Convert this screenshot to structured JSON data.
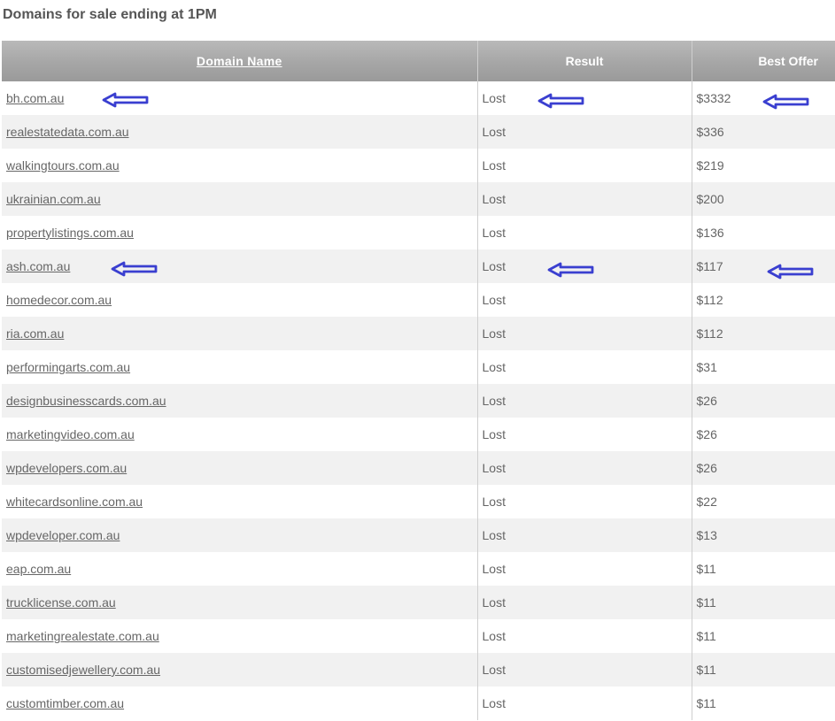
{
  "page": {
    "title": "Domains for sale ending at 1PM"
  },
  "table": {
    "headers": {
      "domain": "Domain Name",
      "result": "Result",
      "offer": "Best Offer"
    },
    "rows": [
      {
        "domain": "bh.com.au",
        "result": "Lost",
        "offer": "$3332"
      },
      {
        "domain": "realestatedata.com.au",
        "result": "Lost",
        "offer": "$336"
      },
      {
        "domain": "walkingtours.com.au",
        "result": "Lost",
        "offer": "$219"
      },
      {
        "domain": "ukrainian.com.au",
        "result": "Lost",
        "offer": "$200"
      },
      {
        "domain": "propertylistings.com.au",
        "result": "Lost",
        "offer": "$136"
      },
      {
        "domain": "ash.com.au",
        "result": "Lost",
        "offer": "$117"
      },
      {
        "domain": "homedecor.com.au",
        "result": "Lost",
        "offer": "$112"
      },
      {
        "domain": "ria.com.au",
        "result": "Lost",
        "offer": "$112"
      },
      {
        "domain": "performingarts.com.au",
        "result": "Lost",
        "offer": "$31"
      },
      {
        "domain": "designbusinesscards.com.au",
        "result": "Lost",
        "offer": "$26"
      },
      {
        "domain": "marketingvideo.com.au",
        "result": "Lost",
        "offer": "$26"
      },
      {
        "domain": "wpdevelopers.com.au",
        "result": "Lost",
        "offer": "$26"
      },
      {
        "domain": "whitecardsonline.com.au",
        "result": "Lost",
        "offer": "$22"
      },
      {
        "domain": "wpdeveloper.com.au",
        "result": "Lost",
        "offer": "$13"
      },
      {
        "domain": "eap.com.au",
        "result": "Lost",
        "offer": "$11"
      },
      {
        "domain": "trucklicense.com.au",
        "result": "Lost",
        "offer": "$11"
      },
      {
        "domain": "marketingrealestate.com.au",
        "result": "Lost",
        "offer": "$11"
      },
      {
        "domain": "customisedjewellery.com.au",
        "result": "Lost",
        "offer": "$11"
      },
      {
        "domain": "customtimber.com.au",
        "result": "Lost",
        "offer": "$11"
      }
    ]
  },
  "annotations": {
    "arrow_color": "#3a3fd0",
    "arrow_icon": "left-arrow-icon",
    "highlighted_domains": [
      "bh.com.au",
      "ash.com.au"
    ]
  }
}
